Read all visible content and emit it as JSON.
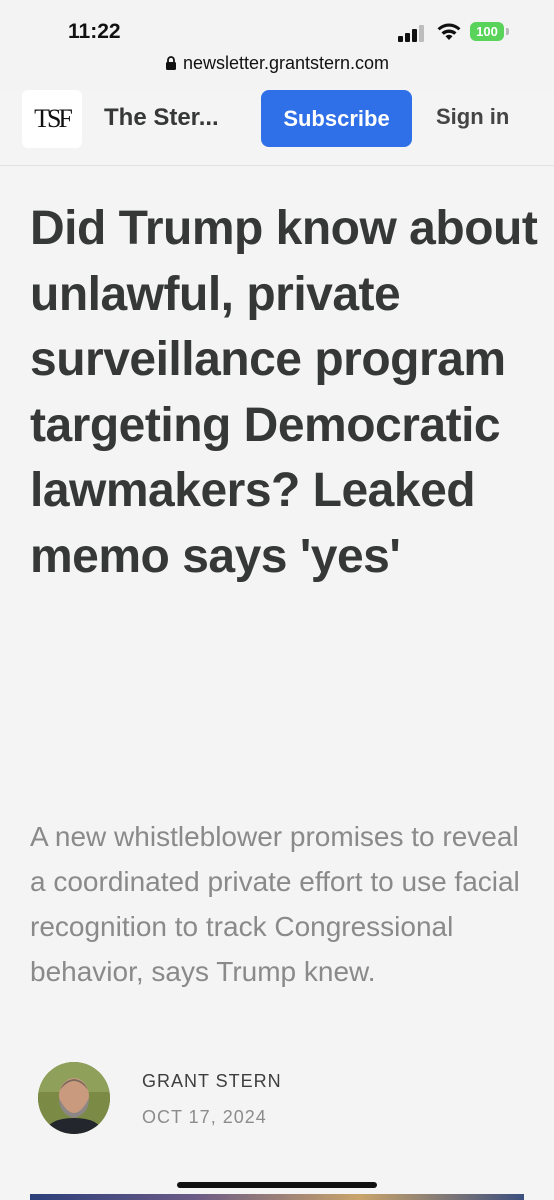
{
  "status_bar": {
    "time": "11:22",
    "battery": "100",
    "battery_color": "#5ad35a"
  },
  "browser": {
    "url": "newsletter.grantstern.com"
  },
  "header": {
    "logo_text": "TSF",
    "publication_name": "The Ster...",
    "subscribe_label": "Subscribe",
    "signin_label": "Sign in",
    "accent_color": "#2f70e8"
  },
  "article": {
    "title": "Did Trump know about unlawful, private surveillance program targeting Democratic lawmakers? Leaked memo says 'yes'",
    "subtitle": "A new whistleblower promises to reveal a coordinated private effort to use facial recognition to track Congressional behavior, says Trump knew.",
    "author": "GRANT STERN",
    "date": "OCT 17, 2024"
  }
}
